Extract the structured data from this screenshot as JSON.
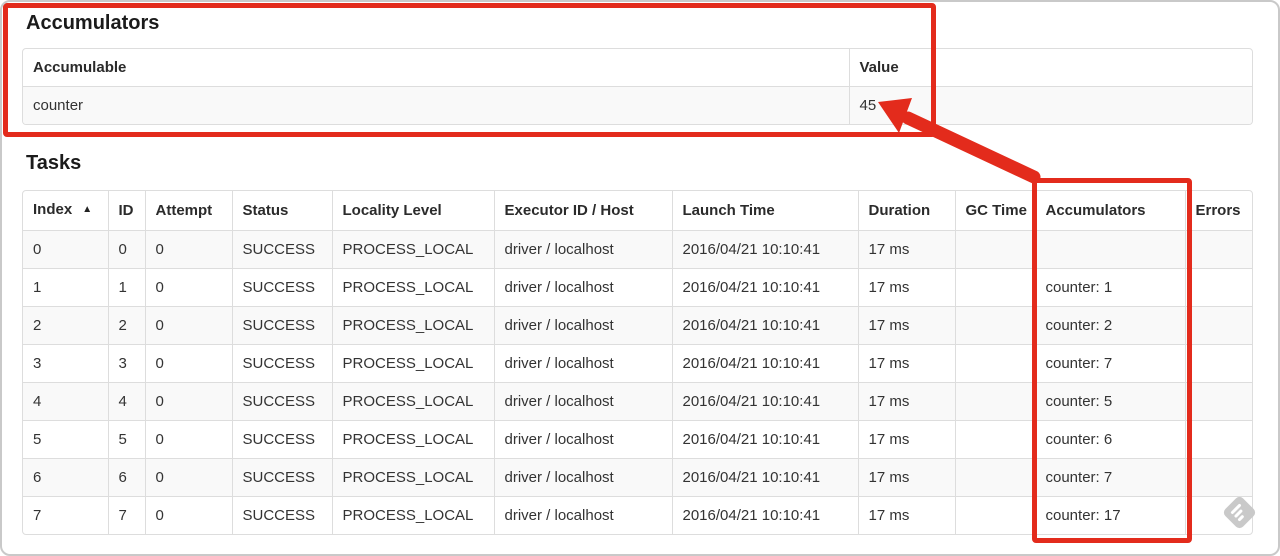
{
  "colors": {
    "annotation_red": "#e32b1c",
    "table_border": "#dddddd",
    "row_stripe": "#f9f9f9",
    "text": "#333333",
    "heading_text": "#1b1b1b",
    "watermark_gray": "#c9c9c9"
  },
  "accumulators_section": {
    "heading": "Accumulators",
    "table": {
      "col_accumulable": "Accumulable",
      "col_value": "Value",
      "rows": [
        {
          "accumulable": "counter",
          "value": "45"
        }
      ]
    }
  },
  "tasks_section": {
    "heading": "Tasks",
    "table": {
      "sort_icon": "▲",
      "headers": [
        "Index",
        "ID",
        "Attempt",
        "Status",
        "Locality Level",
        "Executor ID / Host",
        "Launch Time",
        "Duration",
        "GC Time",
        "Accumulators",
        "Errors"
      ],
      "rows": [
        [
          "0",
          "0",
          "0",
          "SUCCESS",
          "PROCESS_LOCAL",
          "driver / localhost",
          "2016/04/21 10:10:41",
          "17 ms",
          "",
          "",
          ""
        ],
        [
          "1",
          "1",
          "0",
          "SUCCESS",
          "PROCESS_LOCAL",
          "driver / localhost",
          "2016/04/21 10:10:41",
          "17 ms",
          "",
          "counter: 1",
          ""
        ],
        [
          "2",
          "2",
          "0",
          "SUCCESS",
          "PROCESS_LOCAL",
          "driver / localhost",
          "2016/04/21 10:10:41",
          "17 ms",
          "",
          "counter: 2",
          ""
        ],
        [
          "3",
          "3",
          "0",
          "SUCCESS",
          "PROCESS_LOCAL",
          "driver / localhost",
          "2016/04/21 10:10:41",
          "17 ms",
          "",
          "counter: 7",
          ""
        ],
        [
          "4",
          "4",
          "0",
          "SUCCESS",
          "PROCESS_LOCAL",
          "driver / localhost",
          "2016/04/21 10:10:41",
          "17 ms",
          "",
          "counter: 5",
          ""
        ],
        [
          "5",
          "5",
          "0",
          "SUCCESS",
          "PROCESS_LOCAL",
          "driver / localhost",
          "2016/04/21 10:10:41",
          "17 ms",
          "",
          "counter: 6",
          ""
        ],
        [
          "6",
          "6",
          "0",
          "SUCCESS",
          "PROCESS_LOCAL",
          "driver / localhost",
          "2016/04/21 10:10:41",
          "17 ms",
          "",
          "counter: 7",
          ""
        ],
        [
          "7",
          "7",
          "0",
          "SUCCESS",
          "PROCESS_LOCAL",
          "driver / localhost",
          "2016/04/21 10:10:41",
          "17 ms",
          "",
          "counter: 17",
          ""
        ]
      ]
    }
  }
}
